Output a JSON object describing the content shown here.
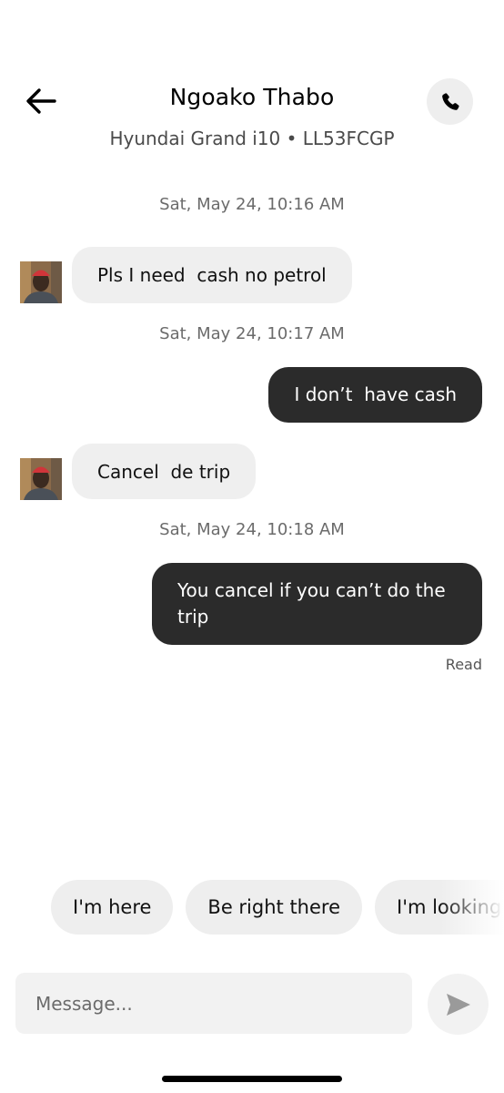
{
  "header": {
    "title": "Ngoako Thabo",
    "subtitle": "Hyundai Grand i10 • LL53FCGP",
    "back_icon": "arrow-left-icon",
    "call_icon": "phone-icon"
  },
  "messages": [
    {
      "timestamp": "Sat, May 24, 10:16 AM",
      "direction": "incoming",
      "text": "Pls I need  cash no petrol"
    },
    {
      "timestamp": "Sat, May 24, 10:17 AM",
      "direction": "outgoing",
      "text": "I don’t  have cash"
    },
    {
      "direction": "incoming",
      "text": "Cancel  de trip"
    },
    {
      "timestamp": "Sat, May 24, 10:18 AM",
      "direction": "outgoing",
      "text": "You cancel if you can’t do the trip",
      "status": "Read"
    }
  ],
  "quick_replies": [
    "I'm here",
    "Be right there",
    "I'm looking f"
  ],
  "composer": {
    "placeholder": "Message...",
    "send_icon": "send-icon"
  },
  "colors": {
    "outgoing_bubble": "#2b2b2b",
    "incoming_bubble": "#efefef",
    "chip_background": "#eeeeee",
    "input_background": "#f2f2f2"
  }
}
